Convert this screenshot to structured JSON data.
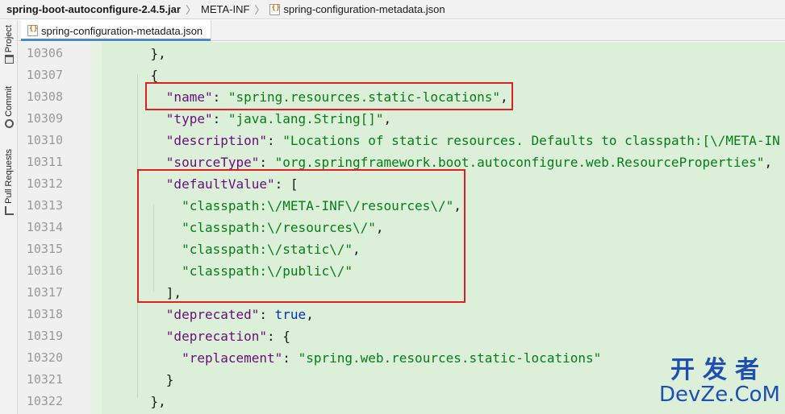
{
  "breadcrumb": {
    "jar": "spring-boot-autoconfigure-2.4.5.jar",
    "folder": "META-INF",
    "file": "spring-configuration-metadata.json"
  },
  "side_tools": {
    "project": "Project",
    "commit": "Commit",
    "pull_requests": "Pull Requests"
  },
  "tab": {
    "label": "spring-configuration-metadata.json"
  },
  "editor": {
    "lines": [
      {
        "num": "10306",
        "tokens": [
          [
            "p",
            "    },"
          ]
        ]
      },
      {
        "num": "10307",
        "tokens": [
          [
            "p",
            "    {"
          ]
        ]
      },
      {
        "num": "10308",
        "tokens": [
          [
            "p",
            "      "
          ],
          [
            "k",
            "\"name\""
          ],
          [
            "p",
            ": "
          ],
          [
            "s",
            "\"spring.resources.static-locations\""
          ],
          [
            "p",
            ","
          ]
        ]
      },
      {
        "num": "10309",
        "tokens": [
          [
            "p",
            "      "
          ],
          [
            "k",
            "\"type\""
          ],
          [
            "p",
            ": "
          ],
          [
            "s",
            "\"java.lang.String[]\""
          ],
          [
            "p",
            ","
          ]
        ]
      },
      {
        "num": "10310",
        "tokens": [
          [
            "p",
            "      "
          ],
          [
            "k",
            "\"description\""
          ],
          [
            "p",
            ": "
          ],
          [
            "s",
            "\"Locations of static resources. Defaults to classpath:[\\/META-IN"
          ]
        ]
      },
      {
        "num": "10311",
        "tokens": [
          [
            "p",
            "      "
          ],
          [
            "k",
            "\"sourceType\""
          ],
          [
            "p",
            ": "
          ],
          [
            "s",
            "\"org.springframework.boot.autoconfigure.web.ResourceProperties\""
          ],
          [
            "p",
            ","
          ]
        ]
      },
      {
        "num": "10312",
        "tokens": [
          [
            "p",
            "      "
          ],
          [
            "k",
            "\"defaultValue\""
          ],
          [
            "p",
            ": ["
          ]
        ]
      },
      {
        "num": "10313",
        "tokens": [
          [
            "p",
            "        "
          ],
          [
            "s",
            "\"classpath:\\/META-INF\\/resources\\/\""
          ],
          [
            "p",
            ","
          ]
        ]
      },
      {
        "num": "10314",
        "tokens": [
          [
            "p",
            "        "
          ],
          [
            "s",
            "\"classpath:\\/resources\\/\""
          ],
          [
            "p",
            ","
          ]
        ]
      },
      {
        "num": "10315",
        "tokens": [
          [
            "p",
            "        "
          ],
          [
            "s",
            "\"classpath:\\/static\\/\""
          ],
          [
            "p",
            ","
          ]
        ]
      },
      {
        "num": "10316",
        "tokens": [
          [
            "p",
            "        "
          ],
          [
            "s",
            "\"classpath:\\/public\\/\""
          ]
        ]
      },
      {
        "num": "10317",
        "tokens": [
          [
            "p",
            "      ],"
          ]
        ]
      },
      {
        "num": "10318",
        "tokens": [
          [
            "p",
            "      "
          ],
          [
            "k",
            "\"deprecated\""
          ],
          [
            "p",
            ": "
          ],
          [
            "b",
            "true"
          ],
          [
            "p",
            ","
          ]
        ]
      },
      {
        "num": "10319",
        "tokens": [
          [
            "p",
            "      "
          ],
          [
            "k",
            "\"deprecation\""
          ],
          [
            "p",
            ": {"
          ]
        ]
      },
      {
        "num": "10320",
        "tokens": [
          [
            "p",
            "        "
          ],
          [
            "k",
            "\"replacement\""
          ],
          [
            "p",
            ": "
          ],
          [
            "s",
            "\"spring.web.resources.static-locations\""
          ]
        ]
      },
      {
        "num": "10321",
        "tokens": [
          [
            "p",
            "      }"
          ]
        ]
      },
      {
        "num": "10322",
        "tokens": [
          [
            "p",
            "    },"
          ]
        ]
      }
    ]
  },
  "watermark": {
    "cn": "开发者",
    "en": "DevZe.CoM"
  },
  "colors": {
    "editor_bg": "#dcefd8",
    "key": "#660e7a",
    "string": "#067d17",
    "keyword": "#0033b3",
    "highlight_box": "#e02020"
  }
}
